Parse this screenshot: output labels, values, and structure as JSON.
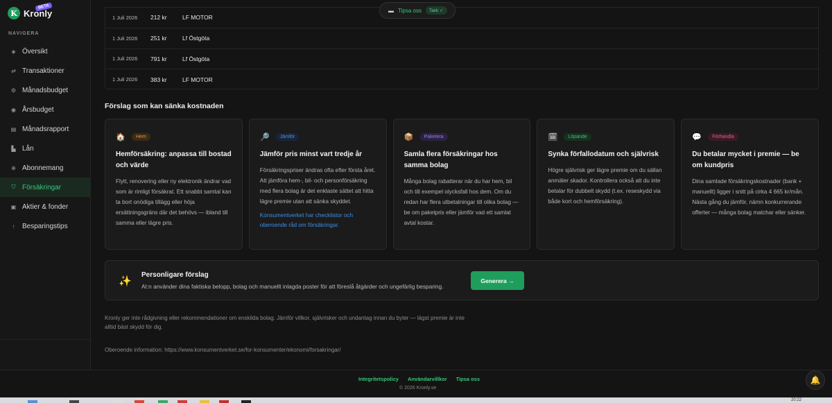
{
  "brand": {
    "logo_letter": "K",
    "name": "Kronly",
    "badge": "BETA"
  },
  "sidebar": {
    "heading": "NAVIGERA",
    "items": [
      {
        "label": "Översikt",
        "icon": "◈",
        "active": false
      },
      {
        "label": "Transaktioner",
        "icon": "⇄",
        "active": false
      },
      {
        "label": "Månadsbudget",
        "icon": "⚙",
        "active": false
      },
      {
        "label": "Årsbudget",
        "icon": "◉",
        "active": false
      },
      {
        "label": "Månadsrapport",
        "icon": "▤",
        "active": false
      },
      {
        "label": "Lån",
        "icon": "▙",
        "active": false
      },
      {
        "label": "Abonnemang",
        "icon": "⊕",
        "active": false
      },
      {
        "label": "Försäkringar",
        "icon": "⛉",
        "active": true
      },
      {
        "label": "Aktier & fonder",
        "icon": "▣",
        "active": false
      },
      {
        "label": "Besparingstips",
        "icon": "↑",
        "active": false
      }
    ]
  },
  "transactions": [
    {
      "date": "1 Juli 2026",
      "amount": "212 kr",
      "merchant": "LF MOTOR"
    },
    {
      "date": "1 Juli 2026",
      "amount": "251 kr",
      "merchant": "Lf Östgöta"
    },
    {
      "date": "1 Juli 2026",
      "amount": "791 kr",
      "merchant": "Lf Östgöta"
    },
    {
      "date": "1 Juli 2026",
      "amount": "383 kr",
      "merchant": "LF MOTOR"
    }
  ],
  "feedback_pill": {
    "label": "Tipsa oss",
    "badge": "Tack ✓"
  },
  "suggestions": {
    "title": "Förslag som kan sänka kostnaden",
    "cards": [
      {
        "icon": "🏠",
        "tag": "Hem",
        "tag_color": "#e0973a",
        "tag_bg": "#3a2a16",
        "title": "Hemförsäkring: anpassa till bostad och värde",
        "body": "Flytt, renovering eller ny elektronik ändrar vad som är rimligt försäkrat. Ett snabbt samtal kan ta bort onödiga tillägg eller höja ersättningsgräns där det behövs — ibland till samma eller lägre pris.",
        "link": ""
      },
      {
        "icon": "🔎",
        "tag": "Jämför",
        "tag_color": "#4f8fe6",
        "tag_bg": "#17253a",
        "title": "Jämför pris minst vart tredje år",
        "body": "Försäkringspriser ändras ofta efter första året. Att jämföra hem-, bil- och personförsäkring med flera bolag är det enklaste sättet att hitta lägre premie utan att sänka skyddet.",
        "link": "Konsumentverket har checklistor och oberoende råd om försäkringar."
      },
      {
        "icon": "📦",
        "tag": "Paketera",
        "tag_color": "#9b7cf0",
        "tag_bg": "#2a2240",
        "title": "Samla flera försäkringar hos samma bolag",
        "body": "Många bolag rabatterar när du har hem, bil och till exempel olycksfall hos dem. Om du redan har flera utbetalningar till olika bolag — be om paketpris eller jämför vad ett samlat avtal kostar.",
        "link": ""
      },
      {
        "icon": "🗓",
        "tag": "Löpande",
        "tag_color": "#36c77a",
        "tag_bg": "#17301f",
        "title": "Synka förfallodatum och självrisk",
        "body": "Högre självrisk ger lägre premie om du sällan anmäler skador. Kontrollera också att du inte betalar för dubbelt skydd (t.ex. reseskydd via både kort och hemförsäkring).",
        "link": ""
      },
      {
        "icon": "💬",
        "tag": "Förhandla",
        "tag_color": "#e0608a",
        "tag_bg": "#3a1a26",
        "title": "Du betalar mycket i premie — be om kundpris",
        "body": "Dina samlade försäkringskostnader (bank + manuellt) ligger i snitt på cirka 4 665 kr/mån. Nästa gång du jämför, nämn konkurrerande offerter — många bolag matchar eller sänker.",
        "link": ""
      }
    ]
  },
  "ai_panel": {
    "icon": "✨",
    "title": "Personligare förslag",
    "text": "AI:n använder dina faktiska belopp, bolag och manuellt inlagda poster för att föreslå åtgärder och ungefärlig besparing.",
    "button": "Generera →"
  },
  "disclaimer": "Kronly ger inte rådgivning eller rekommendationer om enskilda bolag. Jämför villkor, självrisker och undantag innan du byter — lägst premie är inte alltid bäst skydd för dig.",
  "source_info": "Oberoende information: https://www.konsumentverket.se/for-konsumenter/ekonomi/forsakringar/",
  "footer": {
    "links": [
      "Integritetspolicy",
      "Användarvillkor",
      "Tipsa oss"
    ],
    "copyright": "© 2026 Kronly.se"
  },
  "taskbar": {
    "clock": "20:22"
  }
}
